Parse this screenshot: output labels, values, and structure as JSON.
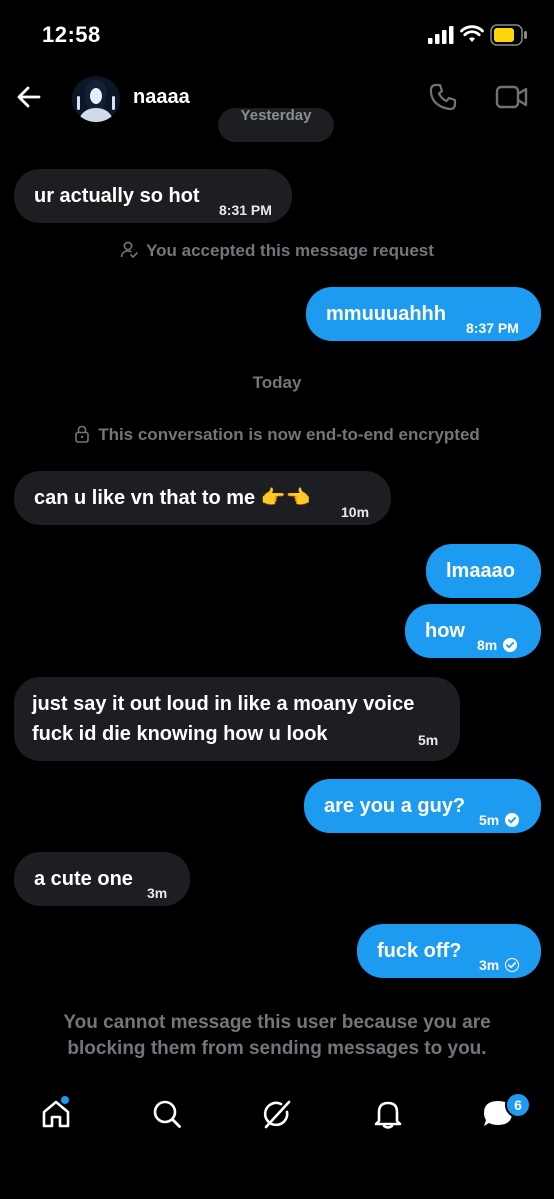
{
  "status": {
    "time": "12:58"
  },
  "header": {
    "contact_name": "naaaa"
  },
  "date_chip": "Yesterday",
  "messages": [
    {
      "dir": "recv",
      "text": "ur actually so hot",
      "time": "8:31 PM"
    },
    {
      "dir": "sys",
      "text": "You accepted this message request",
      "icon": "person-check-icon"
    },
    {
      "dir": "sent",
      "text": "mmuuuahhh",
      "time": "8:37 PM"
    },
    {
      "dir": "sys",
      "text": "Today"
    },
    {
      "dir": "sys",
      "text": "This conversation is now end-to-end encrypted",
      "icon": "lock-icon"
    },
    {
      "dir": "recv",
      "text": "can u like vn that to me 👉👈",
      "time": "10m"
    },
    {
      "dir": "sent",
      "text": "lmaaao",
      "time": ""
    },
    {
      "dir": "sent",
      "text": "how",
      "time": "8m",
      "status": "read-check"
    },
    {
      "dir": "recv",
      "lines": [
        "just say it out loud in like a moany voice",
        "fuck id die knowing how u look"
      ],
      "time": "5m"
    },
    {
      "dir": "sent",
      "text": "are you a guy?",
      "time": "5m",
      "status": "read-check"
    },
    {
      "dir": "recv",
      "text": "a cute one",
      "time": "3m"
    },
    {
      "dir": "sent",
      "text": "fuck off?",
      "time": "3m",
      "status": "sent-check"
    }
  ],
  "blocked_notice": "You cannot message this user because you are blocking them from sending messages to you.",
  "tabbar": {
    "items": [
      "home-icon",
      "search-icon",
      "grok-icon",
      "notifications-icon",
      "messages-icon"
    ],
    "messages_badge": "6"
  },
  "colors": {
    "accent": "#1d9bf0",
    "received_bubble": "#1c1e21",
    "muted_text": "#71767b"
  }
}
